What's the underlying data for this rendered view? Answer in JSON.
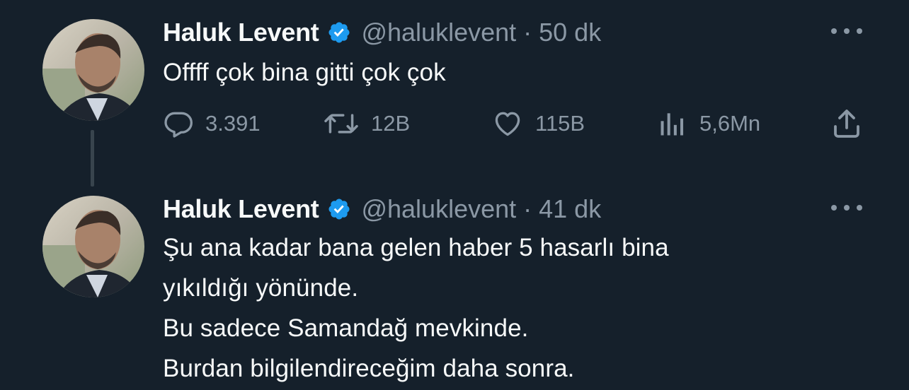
{
  "tweets": [
    {
      "author_name": "Haluk Levent",
      "handle": "@haluklevent",
      "separator": "·",
      "time": "50 dk",
      "text_lines": [
        "Offff çok bina gitti çok çok"
      ],
      "actions": {
        "replies": "3.391",
        "retweets": "12B",
        "likes": "115B",
        "views": "5,6Mn"
      },
      "icons": [
        "verified-badge-icon",
        "more-options-icon",
        "reply-icon",
        "retweet-icon",
        "like-icon",
        "views-icon",
        "share-icon"
      ]
    },
    {
      "author_name": "Haluk Levent",
      "handle": "@haluklevent",
      "separator": "·",
      "time": "41 dk",
      "text_lines": [
        "Şu ana kadar bana gelen haber 5 hasarlı bina",
        "yıkıldığı yönünde.",
        "Bu sadece Samandağ mevkinde.",
        "Burdan bilgilendireceğim daha sonra."
      ],
      "icons": [
        "verified-badge-icon",
        "more-options-icon"
      ]
    }
  ],
  "colors": {
    "background": "#15202b",
    "primary_text": "#f7f9f9",
    "secondary_text": "#8b98a5",
    "verified_blue": "#1d9bf0",
    "thread_line": "#38444d"
  }
}
